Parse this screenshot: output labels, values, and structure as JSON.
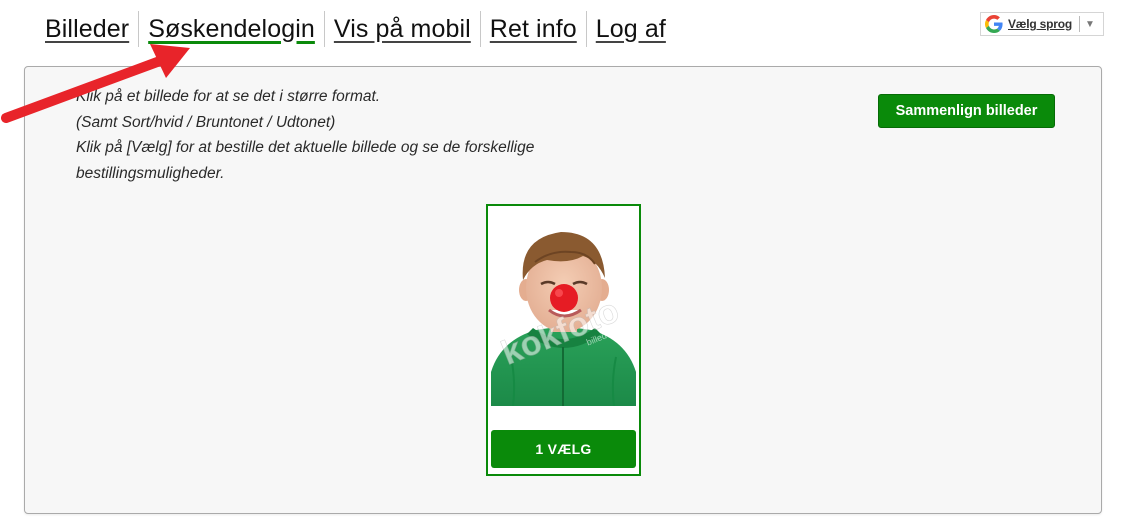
{
  "nav": {
    "items": [
      {
        "label": "Billeder"
      },
      {
        "label": "Søskendelogin"
      },
      {
        "label": "Vis på mobil"
      },
      {
        "label": "Ret info"
      },
      {
        "label": "Log af"
      }
    ]
  },
  "translate": {
    "label": "Vælg sprog",
    "icon": "google-g-icon",
    "dropdown_icon": "triangle-down-icon"
  },
  "info": {
    "line1": "Klik på et billede for at se det i større format.",
    "line2": "(Samt Sort/hvid / Bruntonet / Udtonet)",
    "line3": "Klik på [Vælg] for at bestille det aktuelle billede og se de forskellige",
    "line4": "bestillingsmuligheder."
  },
  "compare_button": {
    "label": "Sammenlign billeder"
  },
  "photo": {
    "watermark_main": "kokfoto",
    "watermark_sub": "billede",
    "select_label": "1 VÆLG"
  },
  "colors": {
    "accent": "#0a8a0a",
    "arrow": "#e8242a"
  }
}
